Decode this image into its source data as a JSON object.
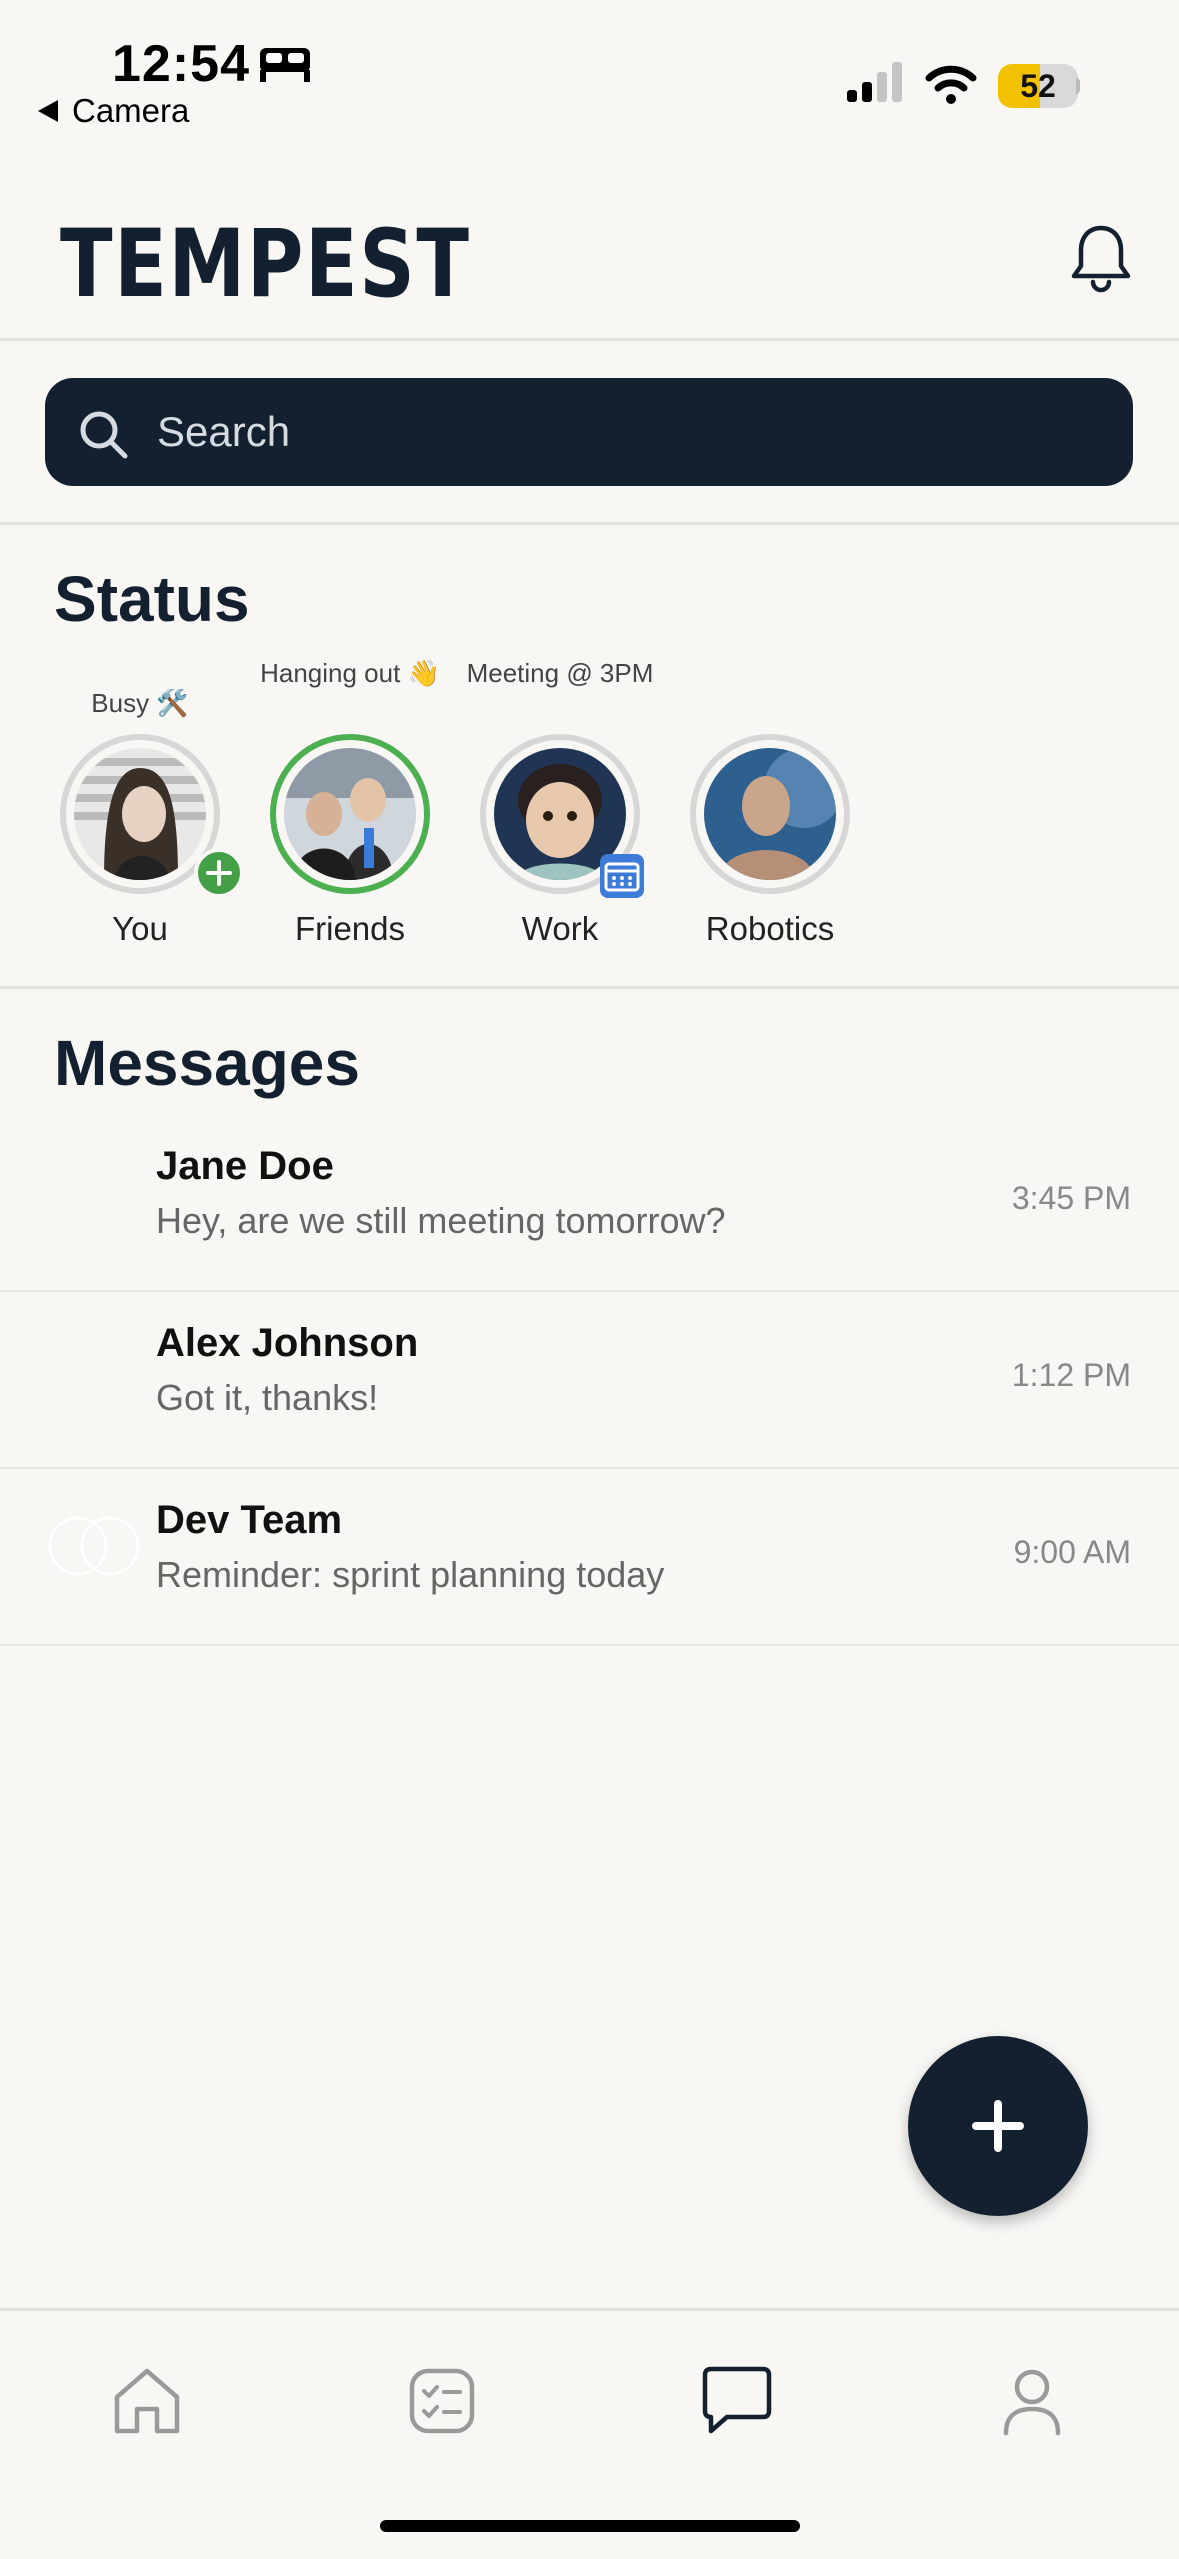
{
  "status_bar": {
    "time": "12:54",
    "back_app": "Camera",
    "battery_percent": 52,
    "battery_label": "52"
  },
  "header": {
    "logo_text": "TEMPEST",
    "bell_icon": "bell-icon"
  },
  "search": {
    "placeholder": "Search",
    "icon": "search-icon"
  },
  "status_section": {
    "title": "Status",
    "stories": [
      {
        "status": "Busy 🛠️",
        "name": "You",
        "badge": "add",
        "active": false
      },
      {
        "status": "Hanging out 👋",
        "name": "Friends",
        "badge": "",
        "active": true
      },
      {
        "status": "Meeting @ 3PM",
        "name": "Work",
        "badge": "calendar",
        "active": false
      },
      {
        "status": "",
        "name": "Robotics",
        "badge": "",
        "active": false
      }
    ]
  },
  "messages_section": {
    "title": "Messages",
    "items": [
      {
        "name": "Jane Doe",
        "preview": "Hey, are we still meeting tomorrow?",
        "time": "3:45 PM"
      },
      {
        "name": "Alex Johnson",
        "preview": "Got it, thanks!",
        "time": "1:12 PM"
      },
      {
        "name": "Dev Team",
        "preview": "Reminder: sprint planning today",
        "time": "9:00 AM"
      }
    ]
  },
  "fab": {
    "icon": "plus-icon"
  },
  "tab_bar": {
    "tabs": [
      {
        "icon": "home-icon"
      },
      {
        "icon": "checklist-icon"
      },
      {
        "icon": "chat-bubble-icon",
        "selected": true
      },
      {
        "icon": "profile-icon"
      }
    ]
  },
  "colors": {
    "primary": "#12202f",
    "background": "#f8f7f4",
    "active_ring": "#4caf50",
    "battery": "#f2c200"
  }
}
